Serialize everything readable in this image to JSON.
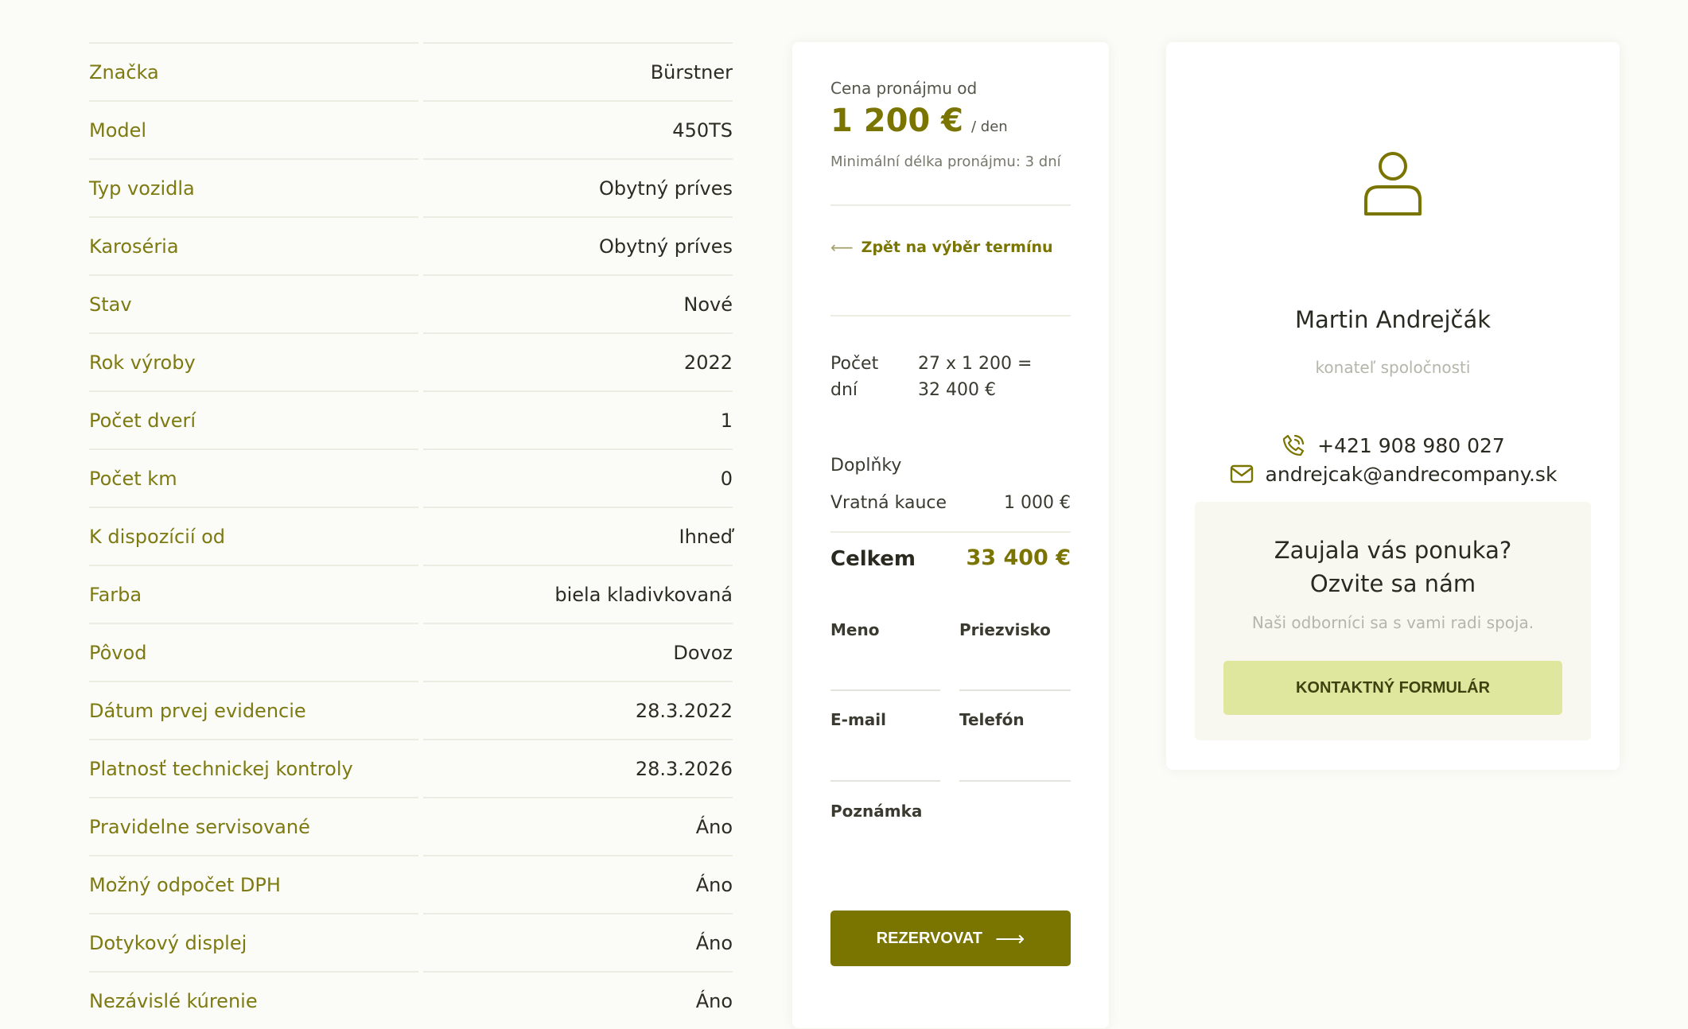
{
  "specs": [
    {
      "label": "Značka",
      "value": "Bürstner"
    },
    {
      "label": "Model",
      "value": "450TS"
    },
    {
      "label": "Typ vozidla",
      "value": "Obytný príves"
    },
    {
      "label": "Karoséria",
      "value": "Obytný príves"
    },
    {
      "label": "Stav",
      "value": "Nové"
    },
    {
      "label": "Rok výroby",
      "value": "2022"
    },
    {
      "label": "Počet dverí",
      "value": "1"
    },
    {
      "label": "Počet km",
      "value": "0"
    },
    {
      "label": "K dispozícií od",
      "value": "Ihneď"
    },
    {
      "label": "Farba",
      "value": "biela kladivkovaná"
    },
    {
      "label": "Pôvod",
      "value": "Dovoz"
    },
    {
      "label": "Dátum prvej evidencie",
      "value": "28.3.2022"
    },
    {
      "label": "Platnosť technickej kontroly",
      "value": "28.3.2026"
    },
    {
      "label": "Pravidelne servisované",
      "value": "Áno"
    },
    {
      "label": "Možný odpočet DPH",
      "value": "Áno"
    },
    {
      "label": "Dotykový displej",
      "value": "Áno"
    },
    {
      "label": "Nezávislé kúrenie",
      "value": "Áno"
    }
  ],
  "booking": {
    "price_label": "Cena pronájmu od",
    "price_value": "1 200 €",
    "price_unit": "/ den",
    "min_rent": "Minimální délka pronájmu: 3 dní",
    "back_link": "Zpět na výběr termínu",
    "days_label": "Počet dní",
    "days_value": "27 x 1 200 = 32 400 €",
    "addons_label": "Doplňky",
    "deposit_label": "Vratná kauce",
    "deposit_value": "1 000 €",
    "total_label": "Celkem",
    "total_value": "33 400 €",
    "fields": {
      "first_name": "Meno",
      "last_name": "Priezvisko",
      "email": "E-mail",
      "phone": "Telefón",
      "note": "Poznámka"
    },
    "reserve_button": "REZERVOVAT"
  },
  "contact": {
    "name": "Martin Andrejčák",
    "role": "konateľ spoločnosti",
    "phone": "+421 908 980 027",
    "email": "andrejcak@andrecompany.sk",
    "cta_title": "Zaujala vás ponuka? Ozvite sa nám",
    "cta_subtitle": "Naši odborníci sa s vami radi spoja.",
    "cta_button": "KONTAKTNÝ FORMULÁR"
  },
  "icons": {
    "avatar": "user-icon",
    "phone": "phone-icon",
    "email": "mail-icon",
    "back": "arrow-left-icon",
    "reserve": "arrow-right-icon"
  },
  "colors": {
    "accent": "#7a7400",
    "label": "#7d7a12",
    "cta_button": "#dfe79f",
    "background": "#fbfbf7"
  }
}
